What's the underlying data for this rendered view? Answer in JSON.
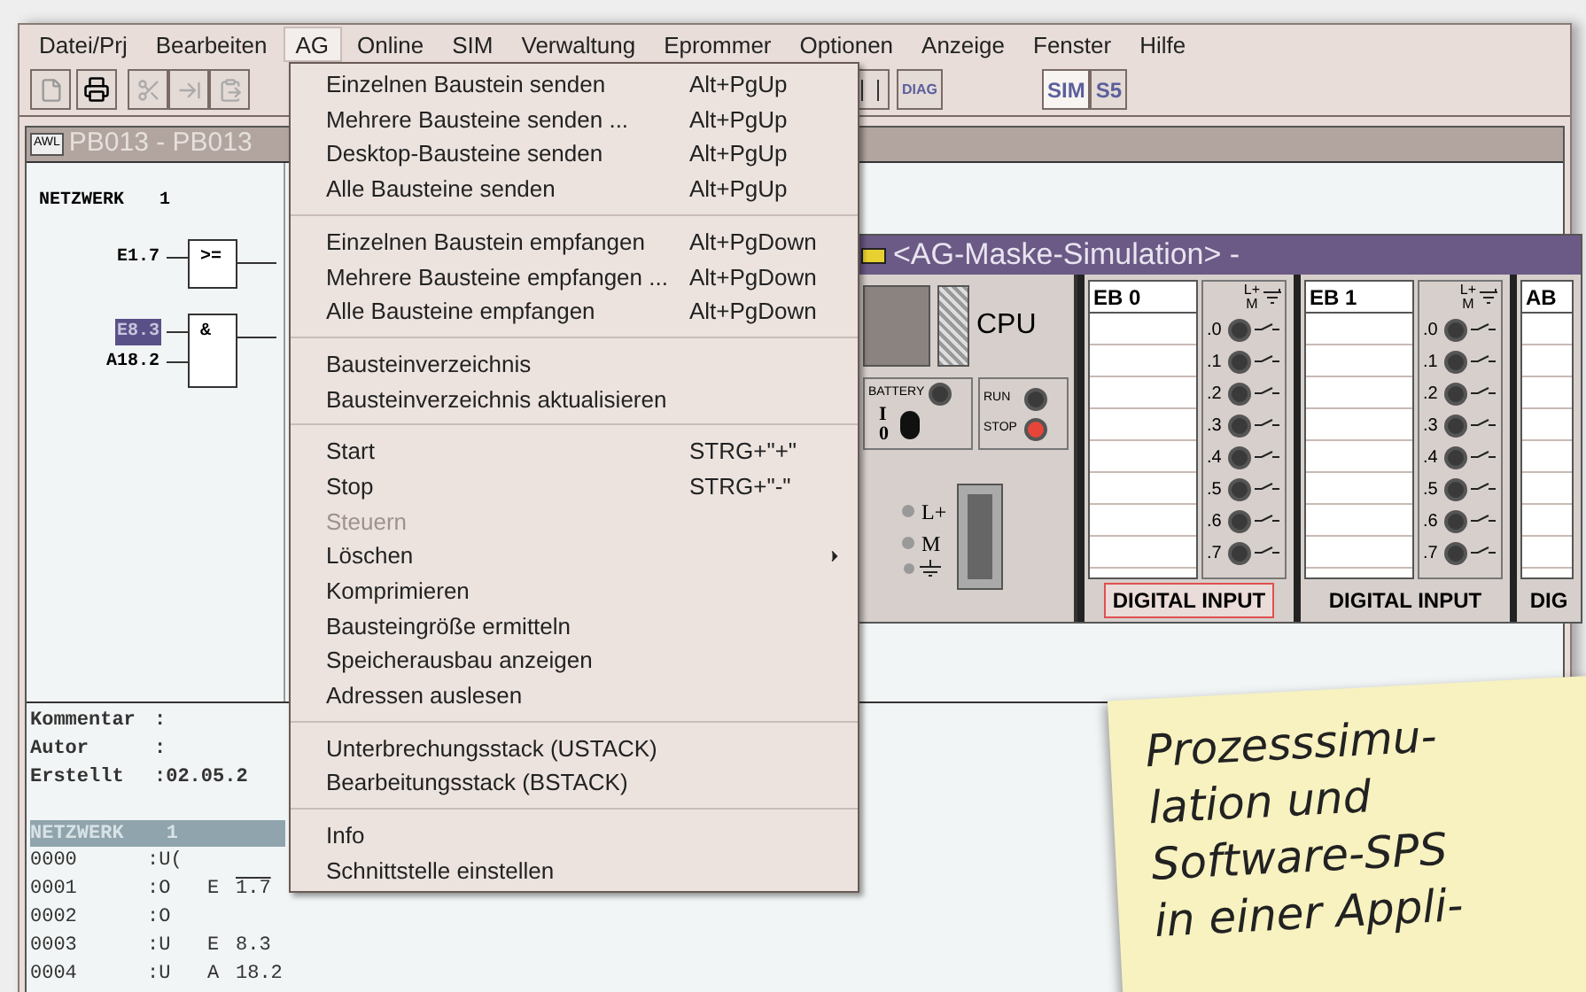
{
  "menubar": [
    {
      "label": "Datei/Prj",
      "selected": false
    },
    {
      "label": "Bearbeiten",
      "selected": false
    },
    {
      "label": "AG",
      "selected": true
    },
    {
      "label": "Online",
      "selected": false
    },
    {
      "label": "SIM",
      "selected": false
    },
    {
      "label": "Verwaltung",
      "selected": false
    },
    {
      "label": "Eprommer",
      "selected": false
    },
    {
      "label": "Optionen",
      "selected": false
    },
    {
      "label": "Anzeige",
      "selected": false
    },
    {
      "label": "Fenster",
      "selected": false
    },
    {
      "label": "Hilfe",
      "selected": false
    }
  ],
  "toolbar": {
    "text_buttons": [
      {
        "label": "DIAG",
        "selected": false
      },
      {
        "label": "SIM",
        "selected": true
      },
      {
        "label": "S5",
        "selected": false
      }
    ]
  },
  "document": {
    "badge": "AWL",
    "title": "PB013 - PB013",
    "ladder": {
      "network": "NETZWERK",
      "number": "1",
      "gates": [
        {
          "symbol": ">=",
          "inputs": [
            {
              "label": "E1.7",
              "selected": false
            }
          ]
        },
        {
          "symbol": "&",
          "inputs": [
            {
              "label": "E8.3",
              "selected": true
            },
            {
              "label": "A18.2",
              "selected": false
            }
          ]
        }
      ]
    },
    "info": [
      {
        "key": "Kommentar",
        "value": ":"
      },
      {
        "key": "Autor",
        "value": ":"
      },
      {
        "key": "Erstellt",
        "value": ":02.05.2"
      }
    ],
    "code": {
      "network": "NETZWERK",
      "number": "1",
      "rows": [
        {
          "addr": "0000",
          "op": ":U("
        },
        {
          "addr": "0001",
          "op": ":O",
          "type": "E",
          "operand": "1.7",
          "negated": true
        },
        {
          "addr": "0002",
          "op": ":O"
        },
        {
          "addr": "0003",
          "op": ":U",
          "type": "E",
          "operand": "8.3",
          "negated": false
        },
        {
          "addr": "0004",
          "op": ":U",
          "type": "A",
          "operand": "18.2",
          "negated": false
        }
      ]
    }
  },
  "simulation": {
    "title": "<AG-Maske-Simulation> -",
    "cpu": {
      "label": "CPU",
      "battery": {
        "label": "BATTERY",
        "on": false
      },
      "switch": [
        "I",
        "0"
      ],
      "leds": [
        {
          "label": "RUN",
          "on": false
        },
        {
          "label": "STOP",
          "on": true
        }
      ],
      "power": [
        "L+",
        "M"
      ]
    },
    "modules": [
      {
        "name": "EB 0",
        "supply": [
          "L+",
          "M"
        ],
        "bits": [
          ".0",
          ".1",
          ".2",
          ".3",
          ".4",
          ".5",
          ".6",
          ".7"
        ],
        "footer": "DIGITAL INPUT",
        "selected": true
      },
      {
        "name": "EB 1",
        "supply": [
          "L+",
          "M"
        ],
        "bits": [
          ".0",
          ".1",
          ".2",
          ".3",
          ".4",
          ".5",
          ".6",
          ".7"
        ],
        "footer": "DIGITAL INPUT",
        "selected": false
      },
      {
        "name": "AB",
        "footer": "DIG",
        "selected": false
      }
    ]
  },
  "menu": {
    "groups": [
      [
        {
          "kind": "item",
          "label": "Einzelnen Baustein senden",
          "shortcut": "Alt+PgUp",
          "disabled": false
        },
        {
          "kind": "item",
          "label": "Mehrere Bausteine senden ...",
          "shortcut": "Alt+PgUp",
          "disabled": false
        },
        {
          "kind": "item",
          "label": "Desktop-Bausteine senden",
          "shortcut": "Alt+PgUp",
          "disabled": false
        },
        {
          "kind": "item",
          "label": "Alle Bausteine senden",
          "shortcut": "Alt+PgUp",
          "disabled": false
        }
      ],
      [
        {
          "kind": "item",
          "label": "Einzelnen Baustein empfangen",
          "shortcut": "Alt+PgDown",
          "disabled": false
        },
        {
          "kind": "item",
          "label": "Mehrere Bausteine empfangen ...",
          "shortcut": "Alt+PgDown",
          "disabled": false
        },
        {
          "kind": "item",
          "label": "Alle Bausteine empfangen",
          "shortcut": "Alt+PgDown",
          "disabled": false
        }
      ],
      [
        {
          "kind": "item",
          "label": "Bausteinverzeichnis",
          "disabled": false
        },
        {
          "kind": "item",
          "label": "Bausteinverzeichnis aktualisieren",
          "disabled": false
        }
      ],
      [
        {
          "kind": "item",
          "label": "Start",
          "shortcut": "STRG+\"+\"",
          "disabled": false
        },
        {
          "kind": "item",
          "label": "Stop",
          "shortcut": "STRG+\"-\"",
          "disabled": false
        },
        {
          "kind": "item",
          "label": "Steuern",
          "disabled": true
        },
        {
          "kind": "submenu",
          "label": "Löschen",
          "disabled": false
        },
        {
          "kind": "item",
          "label": "Komprimieren",
          "disabled": false
        },
        {
          "kind": "item",
          "label": "Bausteingröße ermitteln",
          "disabled": false
        },
        {
          "kind": "item",
          "label": "Speicherausbau anzeigen",
          "disabled": false
        },
        {
          "kind": "item",
          "label": "Adressen auslesen",
          "disabled": false
        }
      ],
      [
        {
          "kind": "item",
          "label": "Unterbrechungsstack (USTACK)",
          "disabled": false
        },
        {
          "kind": "item",
          "label": "Bearbeitungsstack (BSTACK)",
          "disabled": false
        }
      ],
      [
        {
          "kind": "item",
          "label": "Info",
          "disabled": false
        },
        {
          "kind": "item",
          "label": "Schnittstelle einstellen",
          "disabled": false
        }
      ]
    ]
  },
  "note": {
    "lines": [
      "Prozesssimu-",
      "lation und",
      "Software-SPS",
      "in einer Appli-"
    ]
  }
}
